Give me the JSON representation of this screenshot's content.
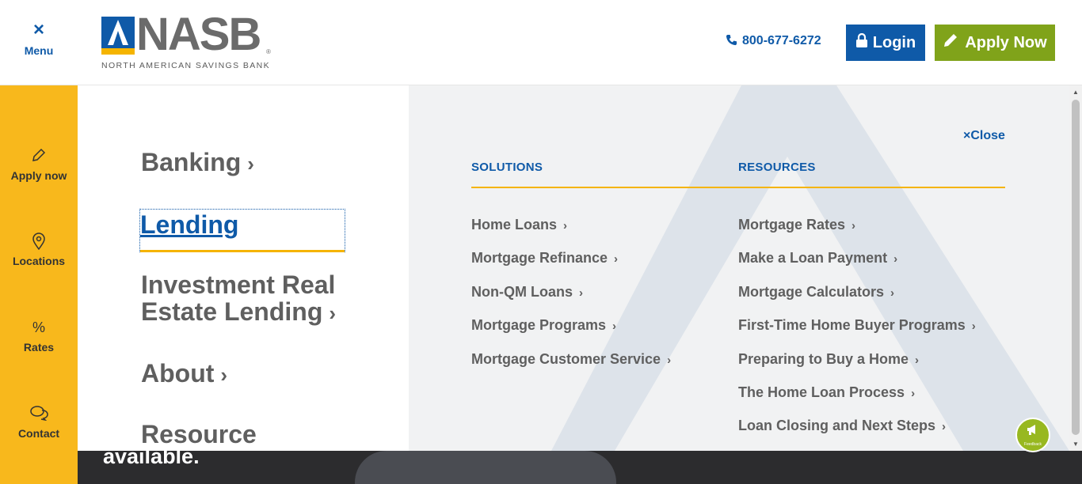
{
  "header": {
    "menu_close_icon": "×",
    "menu_label": "Menu",
    "logo_wordmark": "NASB",
    "logo_registered": "®",
    "logo_subtitle": "NORTH AMERICAN SAVINGS BANK",
    "phone_icon": "phone-icon",
    "phone": "800-677-6272",
    "login_label": "Login",
    "apply_label": "Apply Now"
  },
  "sidebar": {
    "items": [
      {
        "icon": "pencil-icon",
        "glyph": "✎",
        "label": "Apply now"
      },
      {
        "icon": "map-pin-icon",
        "glyph": "⌖",
        "label": "Locations"
      },
      {
        "icon": "percent-icon",
        "glyph": "%",
        "label": "Rates"
      },
      {
        "icon": "chat-icon",
        "glyph": "💬",
        "label": "Contact"
      }
    ]
  },
  "menu": {
    "nav": [
      {
        "label": "Banking",
        "chevron": "›"
      },
      {
        "label": "Lending",
        "active": true
      },
      {
        "label": "Investment Real",
        "label2": "Estate Lending",
        "chevron": "›"
      },
      {
        "label": "About",
        "chevron": "›"
      },
      {
        "label": "Resource"
      }
    ],
    "close_label": "Close",
    "close_icon": "×",
    "solutions_heading": "SOLUTIONS",
    "resources_heading": "RESOURCES",
    "solutions": [
      "Home Loans",
      "Mortgage Refinance",
      "Non-QM Loans",
      "Mortgage Programs",
      "Mortgage Customer Service"
    ],
    "resources": [
      "Mortgage Rates",
      "Make a Loan Payment",
      "Mortgage Calculators",
      "First-Time Home Buyer Programs",
      "Preparing to Buy a Home",
      "The Home Loan Process",
      "Loan Closing and Next Steps"
    ],
    "chevron": "›"
  },
  "hero": {
    "text": "available."
  },
  "feedback": {
    "icon": "megaphone-icon",
    "label": "Feedback"
  },
  "colors": {
    "brand_blue": "#0f5aa8",
    "brand_yellow": "#f8b81c",
    "apply_green": "#80a31a"
  }
}
